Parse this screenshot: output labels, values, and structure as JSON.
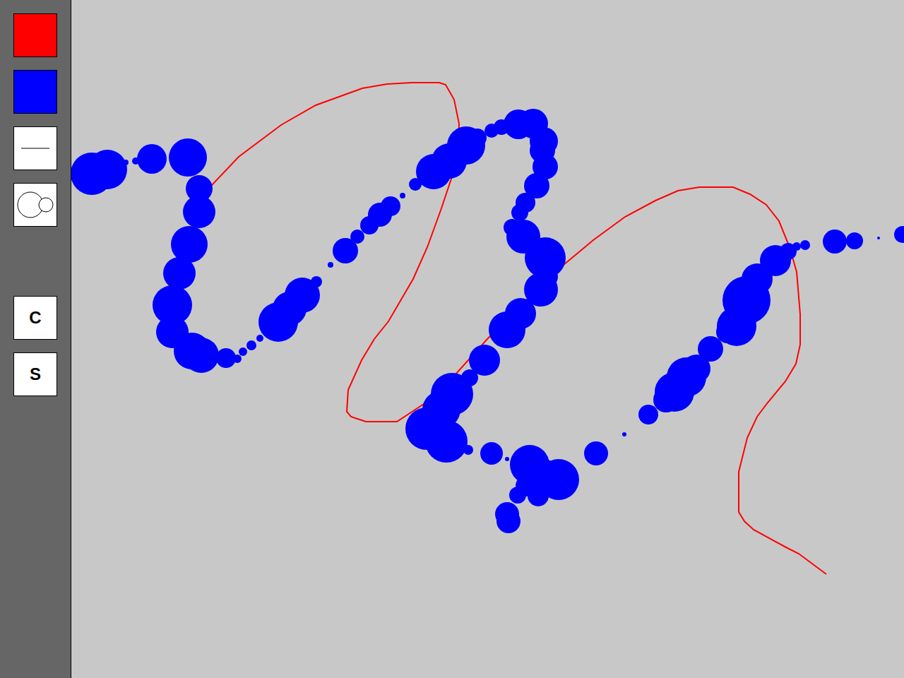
{
  "toolbar": {
    "tools": [
      {
        "kind": "swatch",
        "color": "#ff0000"
      },
      {
        "kind": "swatch",
        "color": "#0000ff"
      },
      {
        "kind": "line-tool"
      },
      {
        "kind": "circle-tool"
      }
    ],
    "actions": [
      {
        "label": "C"
      },
      {
        "label": "S"
      }
    ]
  },
  "canvas": {
    "strokes": [
      {
        "kind": "polyline",
        "color": "#ff0000"
      },
      {
        "kind": "circles",
        "color": "#0000ff"
      }
    ]
  }
}
